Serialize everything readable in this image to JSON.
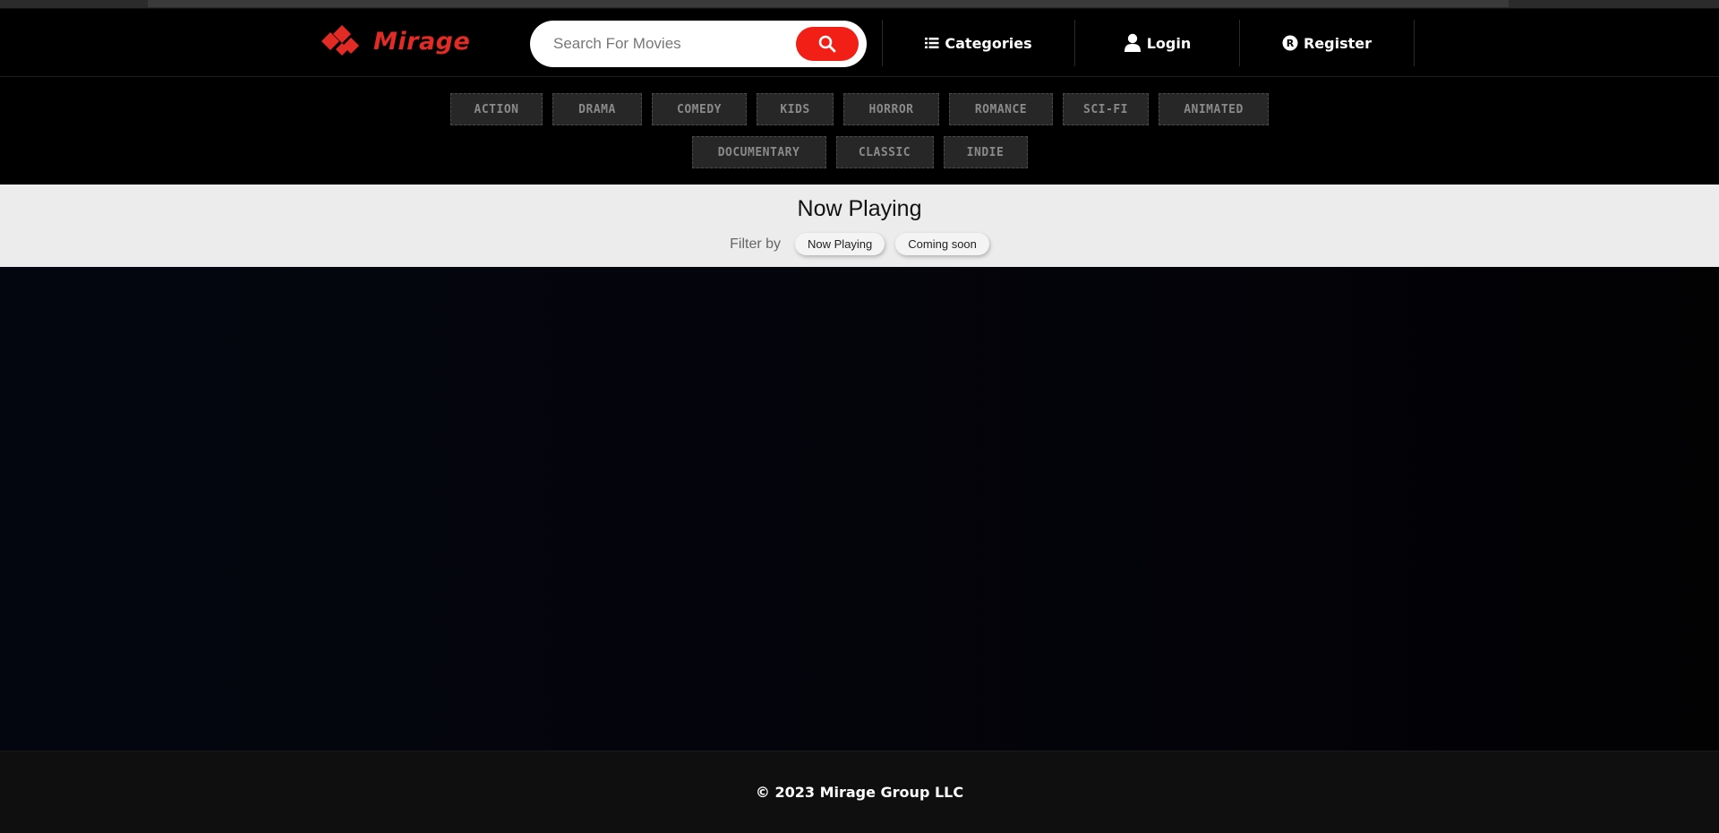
{
  "brand": {
    "name": "Mirage",
    "color": "#e32b26"
  },
  "search": {
    "placeholder": "Search For Movies",
    "icon": "search-icon"
  },
  "nav": {
    "categories_label": "Categories",
    "login_label": "Login",
    "register_label": "Register"
  },
  "genres": {
    "row1": [
      "ACTION",
      "DRAMA",
      "COMEDY",
      "KIDS",
      "HORROR",
      "ROMANCE",
      "SCI-FI",
      "ANIMATED"
    ],
    "row2": [
      "DOCUMENTARY",
      "CLASSIC",
      "INDIE"
    ]
  },
  "section": {
    "title": "Now Playing",
    "filter_label": "Filter by",
    "filters": [
      "Now Playing",
      "Coming soon"
    ]
  },
  "footer": {
    "copyright": "© 2023 Mirage Group LLC"
  }
}
